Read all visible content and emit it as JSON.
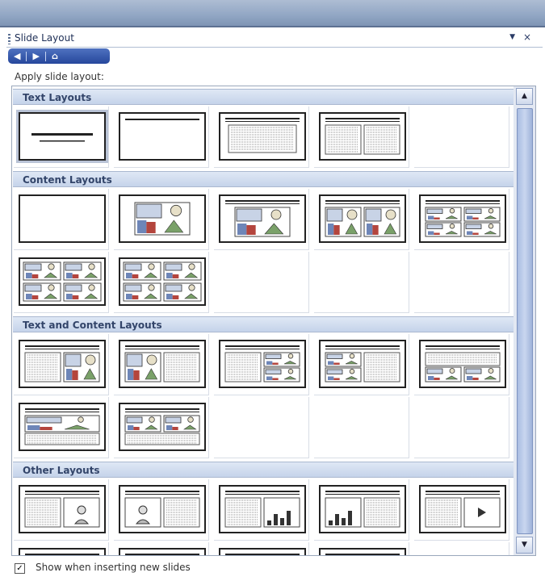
{
  "pane": {
    "title": "Slide Layout",
    "dropdown_glyph": "▼",
    "close_glyph": "×"
  },
  "nav": {
    "back_glyph": "◀",
    "forward_glyph": "▶",
    "home_glyph": "⌂"
  },
  "apply_label": "Apply slide layout:",
  "sections": [
    {
      "title": "Text Layouts",
      "layouts": [
        {
          "kind": "title"
        },
        {
          "kind": "titleonly"
        },
        {
          "kind": "titletext"
        },
        {
          "kind": "titletwocol"
        },
        {
          "kind": "empty"
        }
      ]
    },
    {
      "title": "Content Layouts",
      "layouts": [
        {
          "kind": "blank"
        },
        {
          "kind": "content"
        },
        {
          "kind": "titlecontent"
        },
        {
          "kind": "titletwocontent"
        },
        {
          "kind": "titlefourcontent"
        },
        {
          "kind": "fourcontent"
        },
        {
          "kind": "fourcontent"
        },
        {
          "kind": "empty"
        },
        {
          "kind": "empty"
        },
        {
          "kind": "empty"
        }
      ]
    },
    {
      "title": "Text and Content Layouts",
      "layouts": [
        {
          "kind": "textcontent"
        },
        {
          "kind": "contenttext"
        },
        {
          "kind": "texttwocontent"
        },
        {
          "kind": "twocontenttext"
        },
        {
          "kind": "textovercontent"
        },
        {
          "kind": "contentovertext"
        },
        {
          "kind": "twocontentovertext"
        },
        {
          "kind": "empty"
        },
        {
          "kind": "empty"
        },
        {
          "kind": "empty"
        }
      ]
    },
    {
      "title": "Other Layouts",
      "layouts": [
        {
          "kind": "textclipart"
        },
        {
          "kind": "cliparttext"
        },
        {
          "kind": "textchart"
        },
        {
          "kind": "charttext"
        },
        {
          "kind": "textmedia"
        },
        {
          "kind": "mediatext"
        },
        {
          "kind": "textoverobjects"
        },
        {
          "kind": "orgchart"
        },
        {
          "kind": "chart"
        },
        {
          "kind": "empty"
        }
      ]
    }
  ],
  "scroll": {
    "up_glyph": "▲",
    "down_glyph": "▼"
  },
  "footer": {
    "show_label": "Show when inserting new slides",
    "checked": true,
    "check_glyph": "✓"
  }
}
